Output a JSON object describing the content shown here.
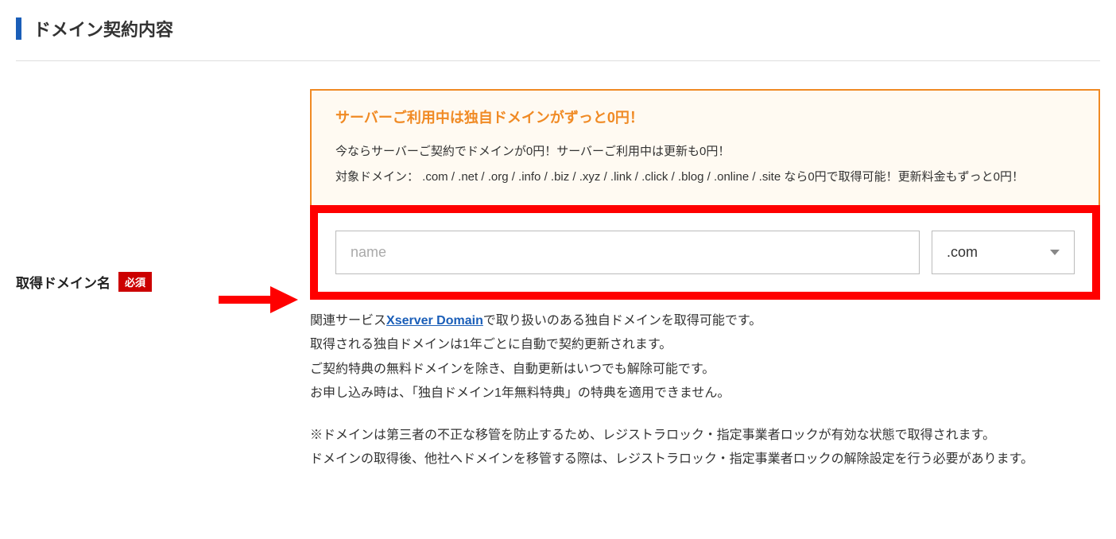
{
  "section": {
    "title": "ドメイン契約内容"
  },
  "form": {
    "label": "取得ドメイン名",
    "required": "必須",
    "placeholder": "name",
    "tld_selected": ".com"
  },
  "promo": {
    "title": "サーバーご利用中は独自ドメインがずっと0円！",
    "body": "今ならサーバーご契約でドメインが0円！サーバーご利用中は更新も0円！\n対象ドメイン： .com / .net / .org / .info / .biz / .xyz / .link / .click / .blog / .online / .site なら0円で取得可能！更新料金もずっと0円！"
  },
  "notes": {
    "line1_prefix": "関連サービス",
    "line1_link": "Xserver Domain",
    "line1_suffix": "で取り扱いのある独自ドメインを取得可能です。",
    "line2": "取得される独自ドメインは1年ごとに自動で契約更新されます。",
    "line3": "ご契約特典の無料ドメインを除き、自動更新はいつでも解除可能です。",
    "line4": "お申し込み時は、「独自ドメイン1年無料特典」の特典を適用できません。",
    "line5": "※ドメインは第三者の不正な移管を防止するため、レジストラロック・指定事業者ロックが有効な状態で取得されます。",
    "line6": "ドメインの取得後、他社へドメインを移管する際は、レジストラロック・指定事業者ロックの解除設定を行う必要があります。"
  }
}
